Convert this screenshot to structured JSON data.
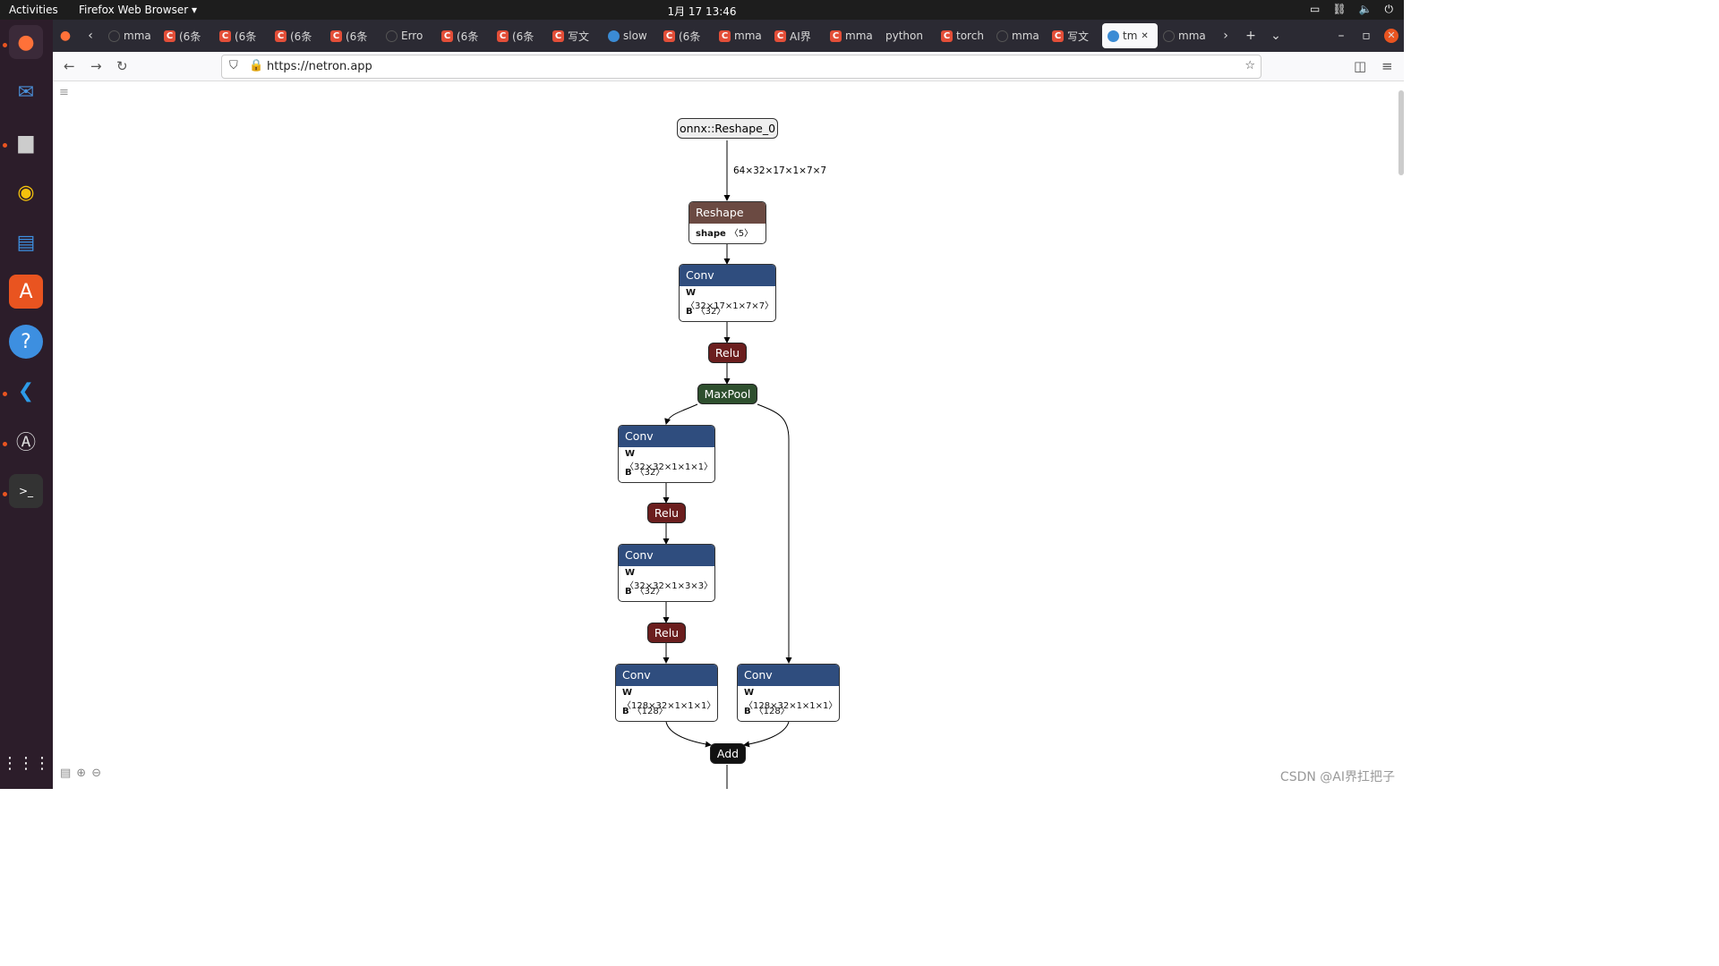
{
  "topbar": {
    "activities": "Activities",
    "app": "Firefox Web Browser ▾",
    "clock": "1月 17  13:46"
  },
  "dock": {
    "items": [
      "firefox-icon",
      "thunderbird-icon",
      "files-icon",
      "rhythmbox-icon",
      "writer-icon",
      "appcenter-icon",
      "help-icon",
      "vscode-icon",
      "updater-icon",
      "terminal-icon"
    ]
  },
  "tabs": [
    {
      "label": "mma",
      "fav": "gh"
    },
    {
      "label": "(6条",
      "fav": "c"
    },
    {
      "label": "(6条",
      "fav": "c"
    },
    {
      "label": "(6条",
      "fav": "c"
    },
    {
      "label": "(6条",
      "fav": "c"
    },
    {
      "label": "Erro",
      "fav": "gh"
    },
    {
      "label": "(6条",
      "fav": "c"
    },
    {
      "label": "(6条",
      "fav": "c"
    },
    {
      "label": "写文",
      "fav": "c"
    },
    {
      "label": "slow",
      "fav": "blue"
    },
    {
      "label": "(6条",
      "fav": "c"
    },
    {
      "label": "mma",
      "fav": "c"
    },
    {
      "label": "AI界",
      "fav": "c"
    },
    {
      "label": "mma",
      "fav": "c"
    },
    {
      "label": "python",
      "fav": "none"
    },
    {
      "label": "torch",
      "fav": "c"
    },
    {
      "label": "mma",
      "fav": "gh"
    },
    {
      "label": "写文",
      "fav": "c"
    },
    {
      "label": "tm",
      "fav": "blue",
      "active": true
    },
    {
      "label": "mma",
      "fav": "gh"
    }
  ],
  "nav": {
    "url": "https://netron.app"
  },
  "graph": {
    "input": "onnx::Reshape_0",
    "edge_label": "64×32×17×1×7×7",
    "reshape": {
      "title": "Reshape",
      "k": "shape",
      "v": "〈5〉"
    },
    "conv1": {
      "title": "Conv",
      "w": "〈32×17×1×7×7〉",
      "b": "〈32〉"
    },
    "relu": "Relu",
    "maxpool": "MaxPool",
    "conv2": {
      "title": "Conv",
      "w": "〈32×32×1×1×1〉",
      "b": "〈32〉"
    },
    "conv3": {
      "title": "Conv",
      "w": "〈32×32×1×3×3〉",
      "b": "〈32〉"
    },
    "conv4": {
      "title": "Conv",
      "w": "〈128×32×1×1×1〉",
      "b": "〈128〉"
    },
    "conv5": {
      "title": "Conv",
      "w": "〈128×32×1×1×1〉",
      "b": "〈128〉"
    },
    "add": "Add",
    "wlabel": "W",
    "blabel": "B"
  },
  "watermark": "CSDN @AI界扛把子",
  "colors": {
    "conv": "#2f4d7e",
    "relu": "#6b1e1e",
    "reshape": "#6b4a42",
    "maxpool": "#2e4f2e",
    "add": "#111111"
  }
}
